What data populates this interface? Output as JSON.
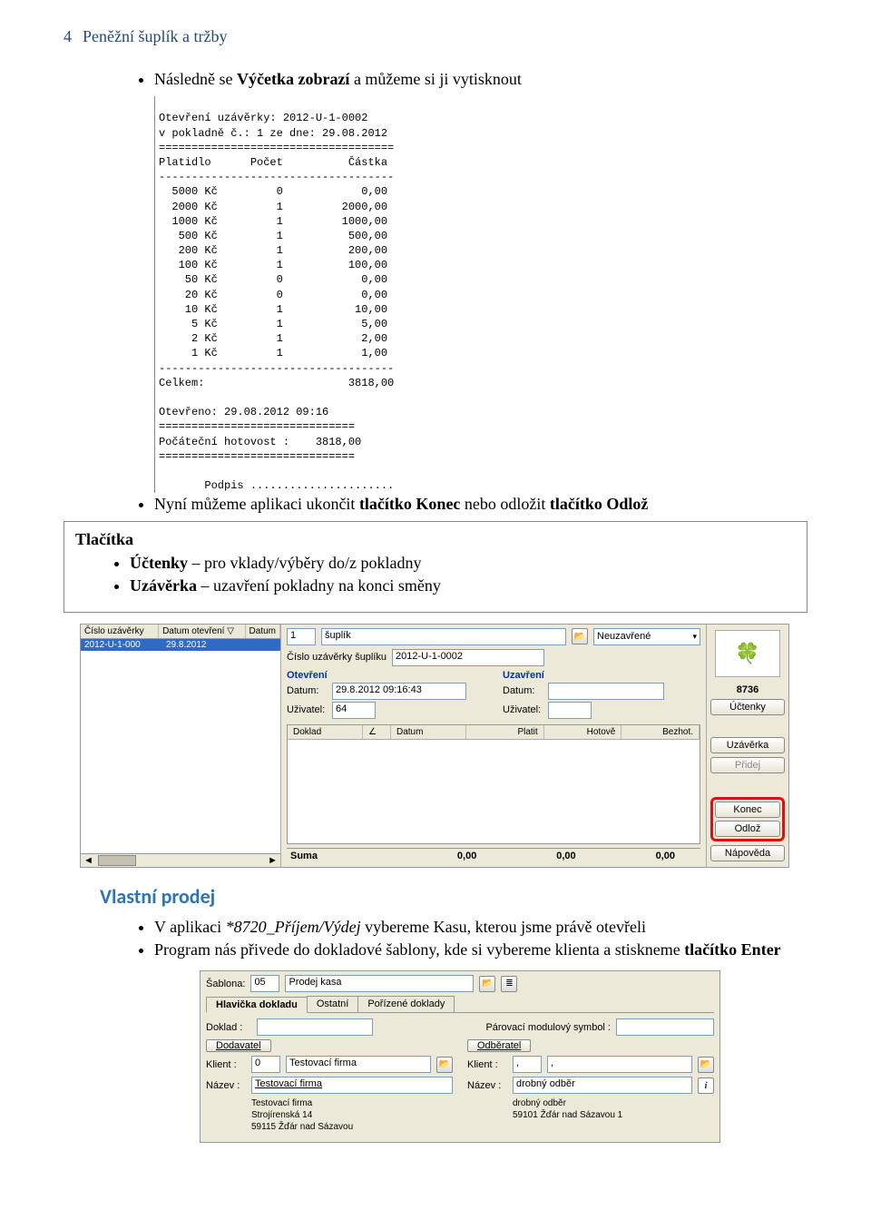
{
  "page_number": "4",
  "header_title": "Peněžní šuplík a tržby",
  "bullets_top": {
    "b1_prefix": "Následně se ",
    "b1_bold": "Výčetka zobrazí",
    "b1_suffix": " a můžeme si ji vytisknout"
  },
  "receipt": {
    "line1": "Otevření uzávěrky: 2012-U-1-0002",
    "line2": "v pokladně č.: 1 ze dne: 29.08.2012",
    "sep_dbl": "====================================",
    "head": "Platidlo      Počet          Částka",
    "sep_sgl": "------------------------------------",
    "rows": [
      "  5000 Kč         0            0,00",
      "  2000 Kč         1         2000,00",
      "  1000 Kč         1         1000,00",
      "   500 Kč         1          500,00",
      "   200 Kč         1          200,00",
      "   100 Kč         1          100,00",
      "    50 Kč         0            0,00",
      "    20 Kč         0            0,00",
      "    10 Kč         1           10,00",
      "     5 Kč         1            5,00",
      "     2 Kč         1            2,00",
      "     1 Kč         1            1,00"
    ],
    "total": "Celkem:                      3818,00",
    "opened": "Otevřeno: 29.08.2012 09:16",
    "sep_dbl2": "==============================",
    "initcash": "Počáteční hotovost :    3818,00",
    "sig": "       Podpis ......................"
  },
  "bullets_mid": {
    "b1_prefix": "Nyní můžeme aplikaci ukončit ",
    "b1_bold1": "tlačítko Konec",
    "b1_mid": " nebo odložit ",
    "b1_bold2": "tlačítko Odlož"
  },
  "callout": {
    "title": "Tlačítka",
    "item1_bold": "Účtenky",
    "item1_rest": " – pro vklady/výběry do/z pokladny",
    "item2_bold": "Uzávěrka",
    "item2_rest": " – uzavření pokladny na konci směny"
  },
  "shot1": {
    "left": {
      "col1": "Číslo uzávěrky",
      "col2": "Datum otevření ▽",
      "col3": "Datum",
      "selrow_col1": "2012-U-1-000",
      "selrow_col2": "29.8.2012"
    },
    "mid": {
      "field_num": "1",
      "field_name": "šuplík",
      "state": "Neuzavřené",
      "line2_label": "Číslo uzávěrky šuplíku",
      "line2_val": "2012-U-1-0002",
      "grp_open": "Otevření",
      "grp_close": "Uzavření",
      "lbl_date": "Datum:",
      "val_date": "29.8.2012 09:16:43",
      "lbl_user": "Uživatel:",
      "val_user": "64",
      "thead": [
        "Doklad",
        "∠",
        "Datum",
        "Platit",
        "Hotově",
        "Bezhot."
      ],
      "suma_lbl": "Suma",
      "suma_v1": "0,00",
      "suma_v2": "0,00",
      "suma_v3": "0,00"
    },
    "right": {
      "num": "8736",
      "btn_uctenky": "Účtenky",
      "btn_uzaverka": "Uzávěrka",
      "btn_pridej": "Přidej",
      "btn_konec": "Konec",
      "btn_odloz": "Odlož",
      "btn_napoveda": "Nápověda"
    }
  },
  "section_heading": "Vlastní prodej",
  "bullets_bot": {
    "b1_prefix": "V aplikaci ",
    "b1_italic": "*8720_Příjem/Výdej",
    "b1_suffix": " vybereme Kasu, kterou jsme právě otevřeli",
    "b2_prefix": "Program nás přivede do dokladové šablony, kde si vybereme klienta a stiskneme ",
    "b2_bold": "tlačítko Enter"
  },
  "shot2": {
    "lbl_sablona": "Šablona:",
    "val_sablona_num": "05",
    "val_sablona_name": "Prodej kasa",
    "tabs": [
      "Hlavička dokladu",
      "Ostatní",
      "Pořízené doklady"
    ],
    "lbl_doklad": "Doklad :",
    "lbl_parov": "Párovací modulový symbol :",
    "fs_dodavatel": "Dodavatel",
    "fs_odberatel": "Odběratel",
    "lbl_klient": "Klient :",
    "lbl_nazev": "Název :",
    "dod_klient_num": "0",
    "dod_klient_name": "Testovací firma",
    "dod_nazev": "Testovací firma",
    "dod_addr1": "Testovací firma",
    "dod_addr2": "Strojírenská 14",
    "dod_addr3": "59115  Žďár nad Sázavou",
    "odb_klient_v1": ",",
    "odb_klient_v2": ",",
    "odb_nazev": "drobný odběr",
    "odb_addr1": "drobný odběr",
    "odb_addr2": "59101  Žďár nad Sázavou 1"
  }
}
